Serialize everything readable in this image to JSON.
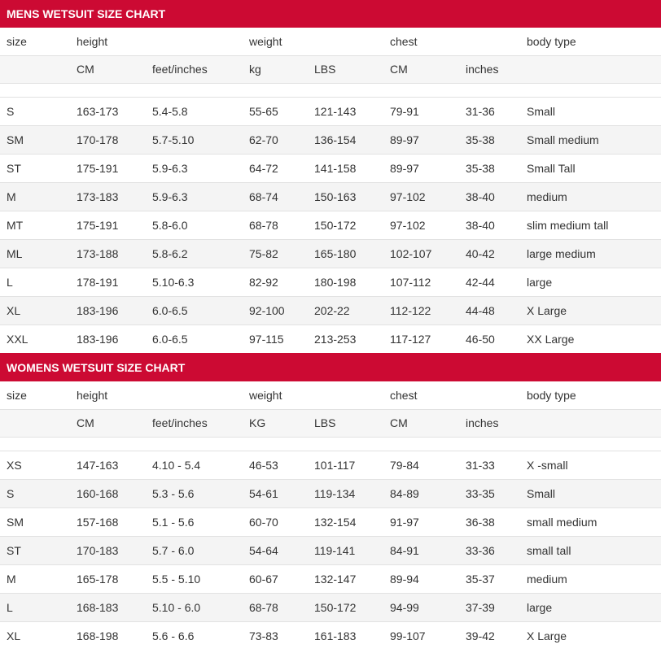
{
  "mens": {
    "title": "MENS WETSUIT SIZE CHART",
    "header": [
      "size",
      "height",
      "",
      "weight",
      "",
      "chest",
      "",
      "body type"
    ],
    "subheader": [
      "",
      "CM",
      "feet/inches",
      "kg",
      "LBS",
      "CM",
      "inches",
      ""
    ],
    "rows": [
      [
        "S",
        "163-173",
        "5.4-5.8",
        "55-65",
        "121-143",
        "79-91",
        "31-36",
        "Small"
      ],
      [
        "SM",
        "170-178",
        "5.7-5.10",
        "62-70",
        "136-154",
        "89-97",
        "35-38",
        "Small medium"
      ],
      [
        "ST",
        "175-191",
        "5.9-6.3",
        "64-72",
        "141-158",
        "89-97",
        "35-38",
        "Small Tall"
      ],
      [
        "M",
        "173-183",
        "5.9-6.3",
        "68-74",
        "150-163",
        "97-102",
        "38-40",
        "medium"
      ],
      [
        "MT",
        "175-191",
        "5.8-6.0",
        "68-78",
        "150-172",
        "97-102",
        "38-40",
        "slim medium tall"
      ],
      [
        "ML",
        "173-188",
        "5.8-6.2",
        "75-82",
        "165-180",
        "102-107",
        "40-42",
        "large medium"
      ],
      [
        "L",
        "178-191",
        "5.10-6.3",
        "82-92",
        "180-198",
        "107-112",
        "42-44",
        "large"
      ],
      [
        "XL",
        "183-196",
        "6.0-6.5",
        "92-100",
        "202-22",
        "112-122",
        "44-48",
        "X Large"
      ],
      [
        "XXL",
        "183-196",
        "6.0-6.5",
        "97-115",
        "213-253",
        "117-127",
        "46-50",
        "XX Large"
      ]
    ]
  },
  "womens": {
    "title": "WOMENS WETSUIT SIZE CHART",
    "header": [
      "size",
      "height",
      "",
      "weight",
      "",
      "chest",
      "",
      "body type"
    ],
    "subheader": [
      "",
      "CM",
      "feet/inches",
      "KG",
      "LBS",
      "CM",
      "inches",
      ""
    ],
    "rows": [
      [
        "XS",
        "147-163",
        "4.10 - 5.4",
        "46-53",
        "101-117",
        "79-84",
        "31-33",
        "X -small"
      ],
      [
        "S",
        "160-168",
        "5.3 - 5.6",
        "54-61",
        "119-134",
        "84-89",
        "33-35",
        "Small"
      ],
      [
        "SM",
        "157-168",
        "5.1 - 5.6",
        "60-70",
        "132-154",
        "91-97",
        "36-38",
        "small medium"
      ],
      [
        "ST",
        "170-183",
        "5.7 - 6.0",
        "54-64",
        "119-141",
        "84-91",
        "33-36",
        "small tall"
      ],
      [
        "M",
        "165-178",
        "5.5 - 5.10",
        "60-67",
        "132-147",
        "89-94",
        "35-37",
        "medium"
      ],
      [
        "L",
        "168-183",
        "5.10 - 6.0",
        "68-78",
        "150-172",
        "94-99",
        "37-39",
        "large"
      ],
      [
        "XL",
        "168-198",
        "5.6 - 6.6",
        "73-83",
        "161-183",
        "99-107",
        "39-42",
        "X Large"
      ]
    ]
  }
}
